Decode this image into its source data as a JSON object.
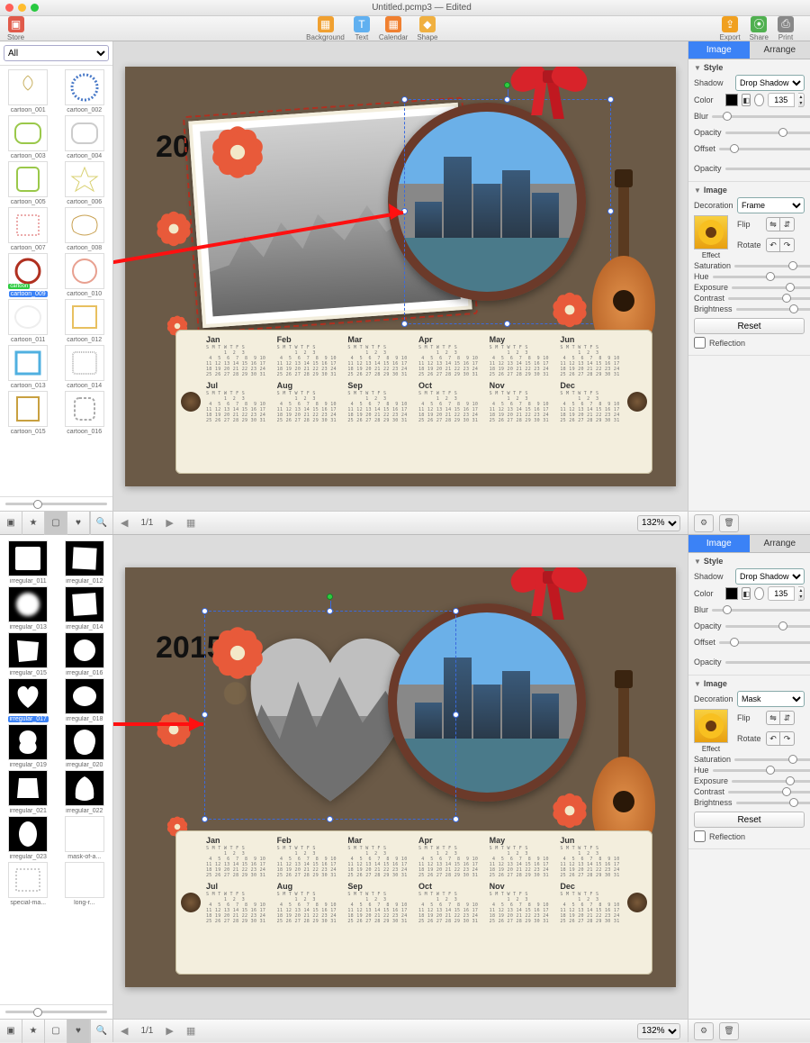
{
  "title": "Untitled.pcmp3 — Edited",
  "toolbar": {
    "store": "Store",
    "background": "Background",
    "text": "Text",
    "calendar": "Calendar",
    "shape": "Shape",
    "export": "Export",
    "share": "Share",
    "print": "Print"
  },
  "leftFilter": "All",
  "cartoonThumbs": [
    "cartoon_001",
    "cartoon_002",
    "cartoon_003",
    "cartoon_004",
    "cartoon_005",
    "cartoon_006",
    "cartoon_007",
    "cartoon_008",
    "cartoon_009",
    "cartoon_010",
    "cartoon_011",
    "cartoon_012",
    "cartoon_013",
    "cartoon_014",
    "cartoon_015",
    "cartoon_016"
  ],
  "cartoonSelected": "cartoon_009",
  "irregularThumbs": [
    "irregular_011",
    "irregular_012",
    "irregular_013",
    "irregular_014",
    "irregular_015",
    "irregular_016",
    "irregular_017",
    "irregular_018",
    "irregular_019",
    "irregular_020",
    "irregular_021",
    "irregular_022",
    "irregular_023",
    "mask-of-a...",
    "special-ma...",
    "long-r..."
  ],
  "irregularSelected": "irregular_017",
  "year": "2015",
  "months": [
    "Jan",
    "Feb",
    "Mar",
    "Apr",
    "May",
    "Jun",
    "Jul",
    "Aug",
    "Sep",
    "Oct",
    "Nov",
    "Dec"
  ],
  "pager": {
    "label": "1/1"
  },
  "zoom": "132%",
  "inspector": {
    "tabs": {
      "image": "Image",
      "arrange": "Arrange"
    },
    "style": {
      "header": "Style",
      "shadow_label": "Shadow",
      "shadow_value": "Drop Shadow",
      "color_label": "Color",
      "angle": "135",
      "blur_label": "Blur",
      "blur": "10",
      "opacity_label": "Opacity",
      "opacity": "50",
      "offset_label": "Offset",
      "offset": "10",
      "opacity2_label": "Opacity",
      "opacity2": "100"
    },
    "image": {
      "header": "Image",
      "decoration_label": "Decoration",
      "decoration_frame": "Frame",
      "decoration_mask": "Mask",
      "flip_label": "Flip",
      "rotate_label": "Rotate",
      "effect_label": "Effect",
      "saturation_label": "Saturation",
      "hue_label": "Hue",
      "exposure_label": "Exposure",
      "contrast_label": "Contrast",
      "brightness_label": "Brightness",
      "reset": "Reset",
      "reflection": "Reflection"
    }
  }
}
